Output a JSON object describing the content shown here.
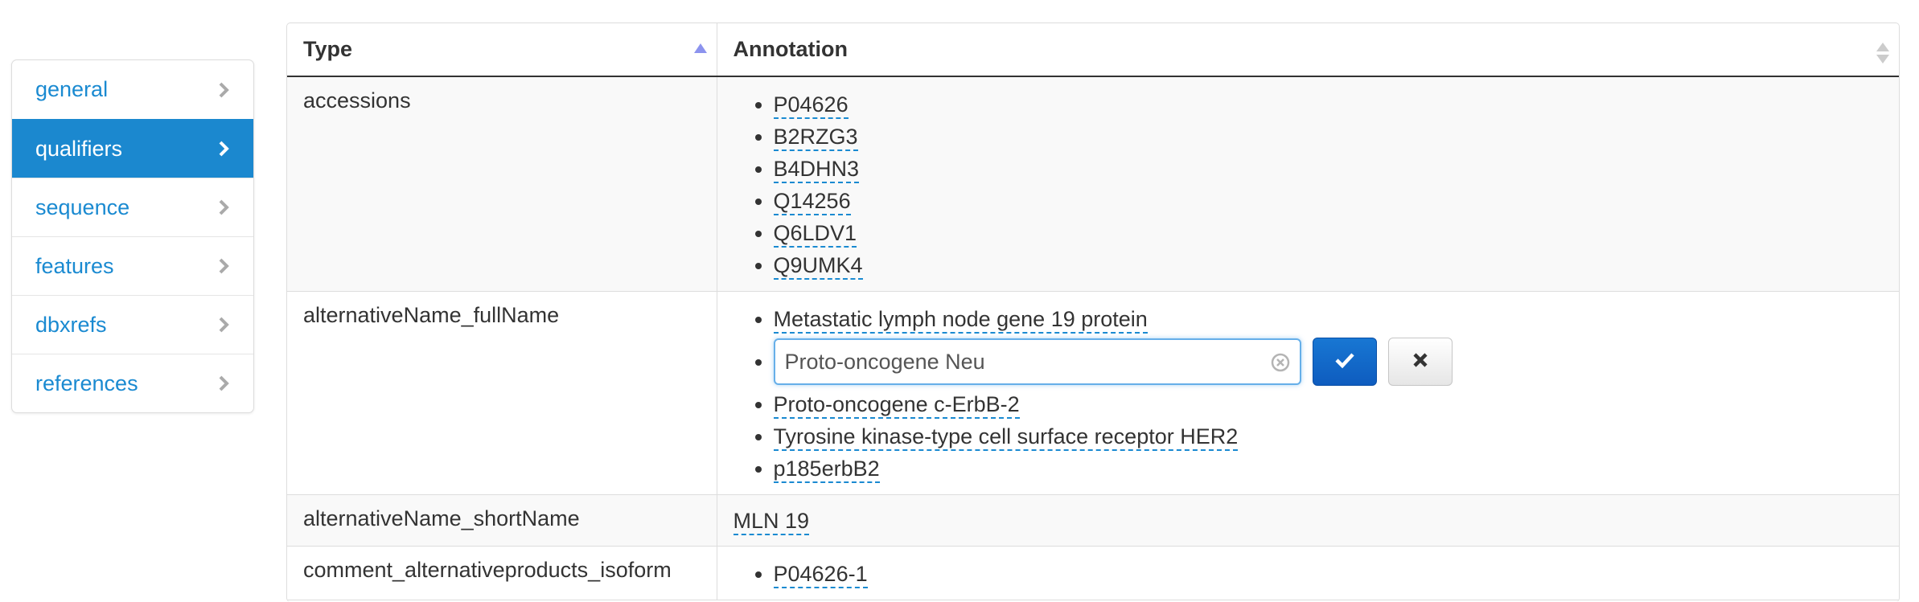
{
  "sidebar": {
    "items": [
      {
        "label": "general"
      },
      {
        "label": "qualifiers"
      },
      {
        "label": "sequence"
      },
      {
        "label": "features"
      },
      {
        "label": "dbxrefs"
      },
      {
        "label": "references"
      }
    ],
    "active": "qualifiers"
  },
  "table": {
    "headers": {
      "type": "Type",
      "annotation": "Annotation"
    },
    "rows": {
      "accessions": {
        "type": "accessions",
        "values": [
          "P04626",
          "B2RZG3",
          "B4DHN3",
          "Q14256",
          "Q6LDV1",
          "Q9UMK4"
        ]
      },
      "alt_full": {
        "type": "alternativeName_fullName",
        "values": [
          "Metastatic lymph node gene 19 protein",
          "Proto-oncogene c-ErbB-2",
          "Tyrosine kinase-type cell surface receptor HER2",
          "p185erbB2"
        ],
        "editing_value": "Proto-oncogene Neu"
      },
      "alt_short": {
        "type": "alternativeName_shortName",
        "value": "MLN 19"
      },
      "isoform": {
        "type": "comment_alternativeproducts_isoform",
        "values": [
          "P04626-1"
        ]
      }
    }
  },
  "icons": {
    "chevron": "chevron-right-icon",
    "sort_asc": "sort-asc-icon",
    "sort_both": "sort-both-icon",
    "clear": "clear-circle-icon",
    "confirm": "check-icon",
    "cancel": "close-icon"
  },
  "colors": {
    "accent": "#1b88cf",
    "link": "#1a8ad1",
    "confirm_button": "#0e5cbf"
  }
}
